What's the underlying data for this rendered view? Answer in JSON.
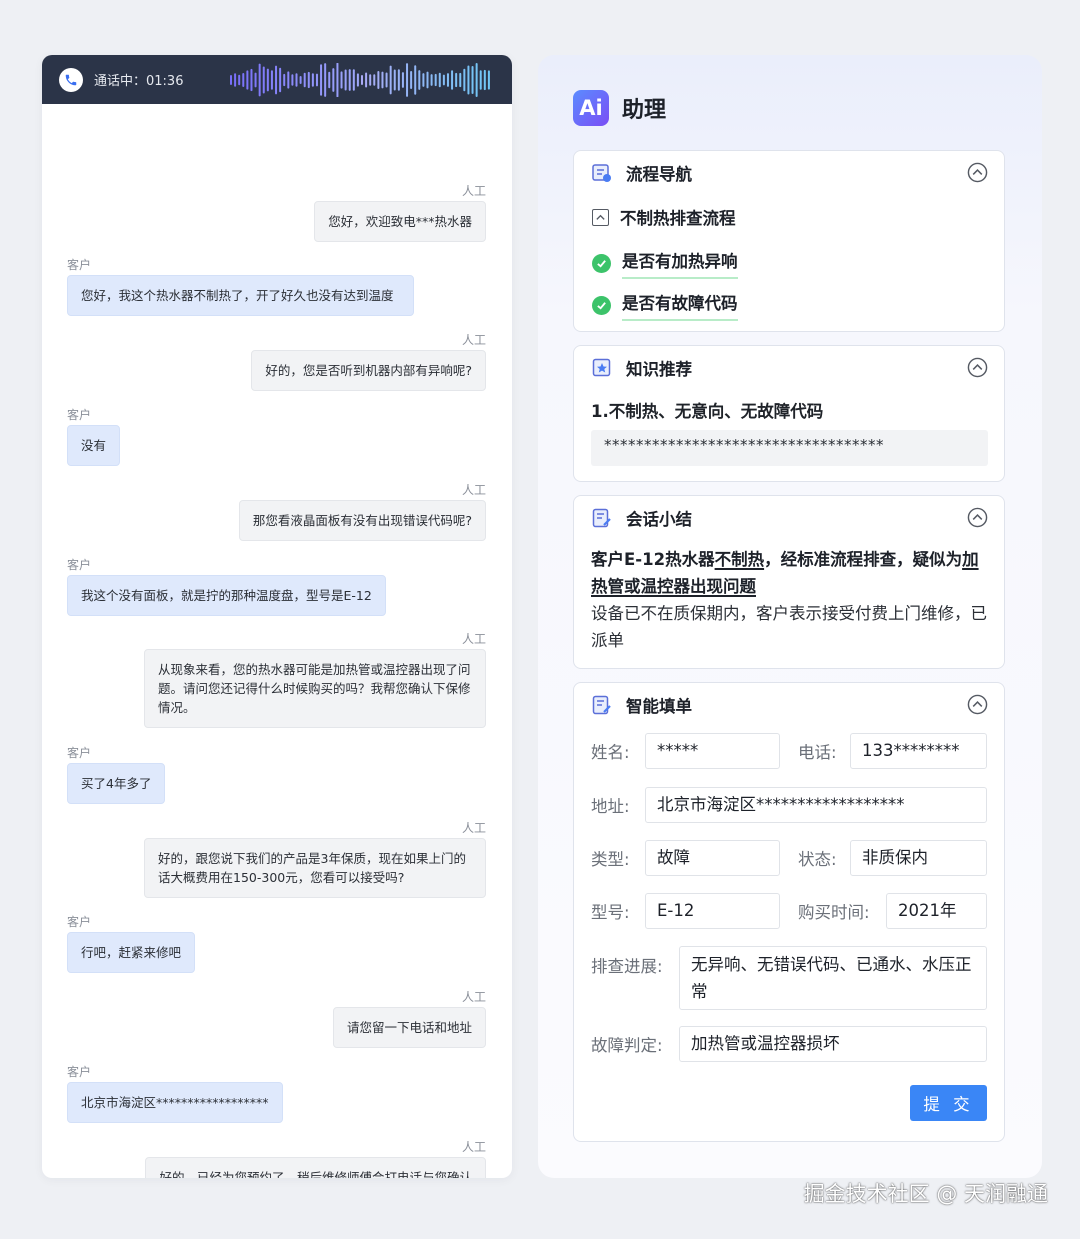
{
  "call": {
    "status": "通话中：01:36"
  },
  "chat": [
    {
      "role": "人工",
      "text": "您好，欢迎致电***热水器"
    },
    {
      "role": "客户",
      "text": "您好，我这个热水器不制热了，开了好久也没有达到温度"
    },
    {
      "role": "人工",
      "text": "好的，您是否听到机器内部有异响呢?"
    },
    {
      "role": "客户",
      "text": "没有"
    },
    {
      "role": "人工",
      "text": "那您看液晶面板有没有出现错误代码呢?"
    },
    {
      "role": "客户",
      "text": "我这个没有面板，就是拧的那种温度盘，型号是E-12"
    },
    {
      "role": "人工",
      "text": "从现象来看，您的热水器可能是加热管或温控器出现了问题。请问您还记得什么时候购买的吗？我帮您确认下保修情况。"
    },
    {
      "role": "客户",
      "text": "买了4年多了"
    },
    {
      "role": "人工",
      "text": "好的，跟您说下我们的产品是3年保质，现在如果上门的话大概费用在150-300元，您看可以接受吗?"
    },
    {
      "role": "客户",
      "text": "行吧，赶紧来修吧"
    },
    {
      "role": "人工",
      "text": "请您留一下电话和地址"
    },
    {
      "role": "客户",
      "text": "北京市海淀区******************"
    },
    {
      "role": "人工",
      "text": "好的，已经为您预约了，稍后维修师傅会打电话与您确认"
    }
  ],
  "assistant": {
    "logo": "Ai",
    "title": "助理",
    "flow": {
      "title": "流程导航",
      "root": "不制热排查流程",
      "steps": [
        "是否有加热异响",
        "是否有故障代码"
      ]
    },
    "knowledge": {
      "title": "知识推荐",
      "item": "1.不制热、无意向、无故障代码",
      "content": "***********************************"
    },
    "summary": {
      "title": "会话小结",
      "p1": [
        "客户E-12热水器",
        "不制热",
        "，经标准流程排查，疑似为",
        "加热管或温控器出现问题"
      ],
      "p2": "设备已不在质保期内，客户表示接受付费上门维修，已派单"
    },
    "form": {
      "title": "智能填单",
      "name_label": "姓名:",
      "name": "*****",
      "phone_label": "电话:",
      "phone": "133********",
      "address_label": "地址:",
      "address": "北京市海淀区******************",
      "type_label": "类型:",
      "type": "故障",
      "state_label": "状态:",
      "state": "非质保内",
      "model_label": "型号:",
      "model": "E-12",
      "buy_label": "购买时间:",
      "buy": "2021年",
      "progress_label": "排查进展:",
      "progress": "无异响、无错误代码、已通水、水压正常",
      "judge_label": "故障判定:",
      "judge": "加热管或温控器损坏",
      "submit": "提 交"
    }
  },
  "watermark": "掘金技术社区 @ 天润融通",
  "colors": {
    "accent": "#3a86f6",
    "success": "#3cc36a",
    "agent_bubble": "#f2f3f5",
    "customer_bubble": "#dfe9fc",
    "call_bar": "#2b3448"
  }
}
